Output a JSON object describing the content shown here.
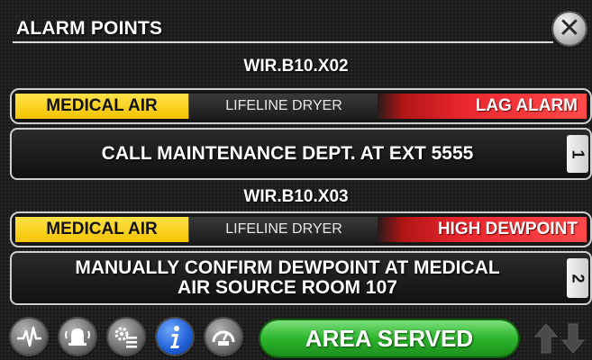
{
  "header": {
    "title": "ALARM POINTS",
    "close_label": "✕"
  },
  "alarms": [
    {
      "point_id": "WIR.B10.X02",
      "gas": "MEDICAL AIR",
      "source": "LIFELINE DRYER",
      "status": "LAG ALARM",
      "message": "CALL MAINTENANCE DEPT. AT EXT 5555",
      "index": "1"
    },
    {
      "point_id": "WIR.B10.X03",
      "gas": "MEDICAL AIR",
      "source": "LIFELINE DRYER",
      "status": "HIGH DEWPOINT",
      "message": "MANUALLY CONFIRM DEWPOINT AT MEDICAL AIR SOURCE ROOM 107",
      "index": "2"
    }
  ],
  "toolbar": {
    "icons": [
      "heartbeat-icon",
      "alarm-bell-icon",
      "settings-list-icon",
      "info-icon",
      "gauge-icon"
    ],
    "area_served_label": "AREA SERVED",
    "arrows": [
      "arrow-up-icon",
      "arrow-down-icon"
    ]
  },
  "colors": {
    "gas_yellow": "#f5c300",
    "alarm_red": "#e8262e",
    "area_green": "#2db52d",
    "info_blue": "#1f5fd6"
  }
}
